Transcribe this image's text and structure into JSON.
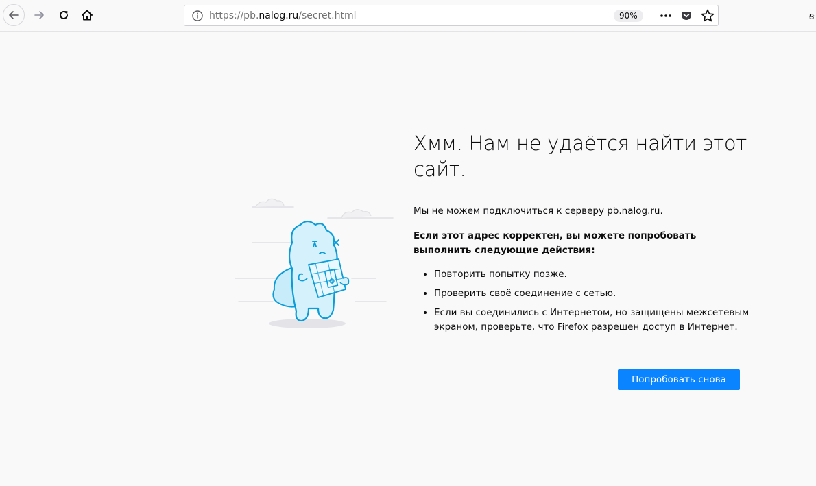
{
  "browser": {
    "url_prefix": "https://pb.",
    "url_domain": "nalog.ru",
    "url_path": "/secret.html",
    "zoom": "90%",
    "overflow_glyph": "ꞩ",
    "icons": [
      "back-arrow-icon",
      "forward-arrow-icon",
      "reload-icon",
      "home-icon",
      "info-icon",
      "page-actions-icon",
      "pocket-icon",
      "bookmark-star-icon"
    ]
  },
  "error_page": {
    "title": "Хмм. Нам не удаётся найти этот сайт.",
    "description": "Мы не можем подключиться к серверу pb.nalog.ru.",
    "suggestion_intro": "Если этот адрес корректен, вы можете попробовать выполнить следующие действия:",
    "suggestions": [
      "Повторить попытку позже.",
      "Проверить своё соединение с сетью.",
      "Если вы соединились с Интернетом, но защищены межсетевым экраном, проверьте, что Firefox разрешен доступ в Интернет."
    ],
    "try_again_label": "Попробовать снова"
  },
  "colors": {
    "accent": "#0a84ff",
    "background": "#f9f9fa",
    "illustration_stroke": "#0a9dd9",
    "illustration_fill": "#d5f1fb"
  }
}
